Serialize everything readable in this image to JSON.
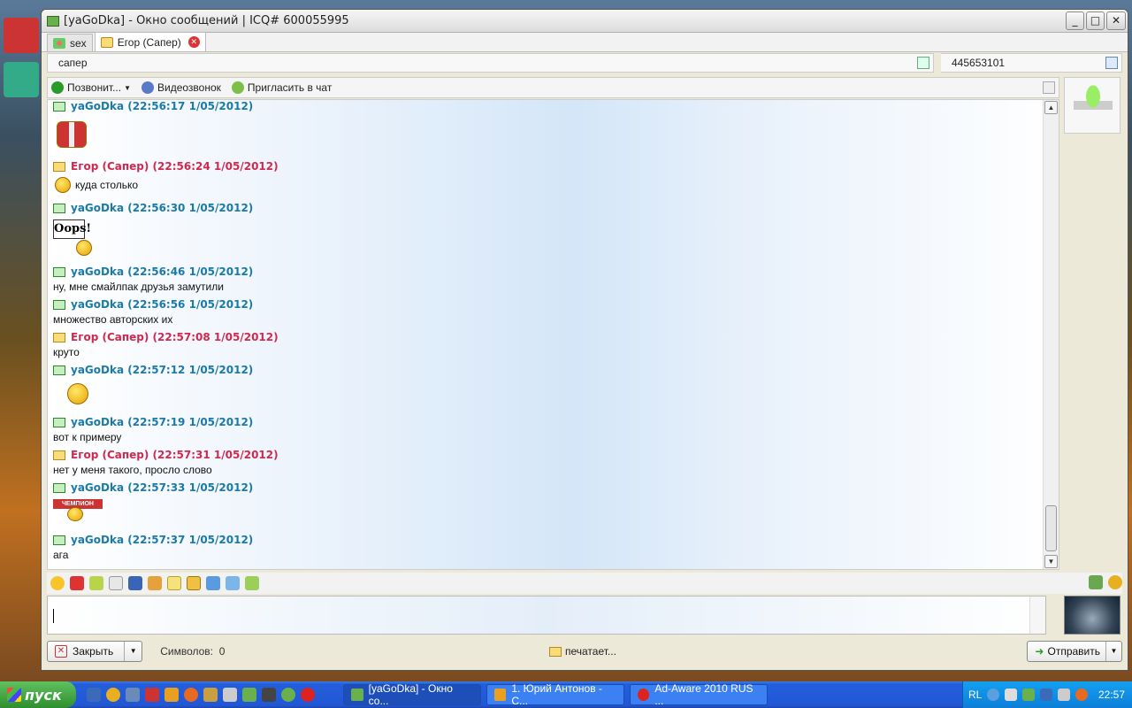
{
  "window": {
    "title": "[yaGoDka] - Окно сообщений | ICQ# 600055995"
  },
  "tabs": [
    {
      "label": "sex"
    },
    {
      "label": "Егор (Сапер)"
    }
  ],
  "info": {
    "contact_name": "сапер",
    "contact_uin": "445653101"
  },
  "actions": {
    "call": "Позвонит...",
    "video": "Видеозвонок",
    "invite": "Пригласить в чат"
  },
  "messages": [
    {
      "sender": "yaGoDka",
      "header": "yaGoDka (22:56:17 1/05/2012)",
      "text": "",
      "self": true
    },
    {
      "sender": "Егор (Сапер)",
      "header": "Егор (Сапер) (22:56:24 1/05/2012)",
      "text": "куда столько",
      "self": false
    },
    {
      "sender": "yaGoDka",
      "header": "yaGoDka (22:56:30 1/05/2012)",
      "text": "",
      "sticker": "Oops!",
      "self": true
    },
    {
      "sender": "yaGoDka",
      "header": "yaGoDka (22:56:46 1/05/2012)",
      "text": "ну, мне смайлпак друзья замутили",
      "self": true
    },
    {
      "sender": "yaGoDka",
      "header": "yaGoDka (22:56:56 1/05/2012)",
      "text": "множество авторских их",
      "self": true
    },
    {
      "sender": "Егор (Сапер)",
      "header": "Егор (Сапер) (22:57:08 1/05/2012)",
      "text": "круто",
      "self": false
    },
    {
      "sender": "yaGoDka",
      "header": "yaGoDka (22:57:12 1/05/2012)",
      "text": "",
      "self": true
    },
    {
      "sender": "yaGoDka",
      "header": "yaGoDka (22:57:19 1/05/2012)",
      "text": "вот к примеру",
      "self": true
    },
    {
      "sender": "Егор (Сапер)",
      "header": "Егор (Сапер) (22:57:31 1/05/2012)",
      "text": "нет у меня такого, просло слово",
      "self": false
    },
    {
      "sender": "yaGoDka",
      "header": "yaGoDka (22:57:33 1/05/2012)",
      "text": "",
      "sticker": "ЧЕМПИОН",
      "self": true
    },
    {
      "sender": "yaGoDka",
      "header": "yaGoDka (22:57:37 1/05/2012)",
      "text": "ага",
      "self": true
    }
  ],
  "bottom": {
    "close_label": "Закрыть",
    "chars_label": "Символов:",
    "chars_count": "0",
    "typing_label": "печатает...",
    "send_label": "Отправить"
  },
  "taskbar": {
    "start_label": "пуск",
    "tasks": [
      {
        "label": "[yaGoDka] - Окно со..."
      },
      {
        "label": "1. Юрий Антонов - С..."
      },
      {
        "label": "Ad-Aware 2010 RUS ..."
      }
    ],
    "lang": "RL",
    "clock": "22:57"
  },
  "colors": {
    "self_name": "#1a7aa8",
    "other_name": "#d0294f",
    "taskbar": "#245edc",
    "start": "#2f8f2f"
  }
}
